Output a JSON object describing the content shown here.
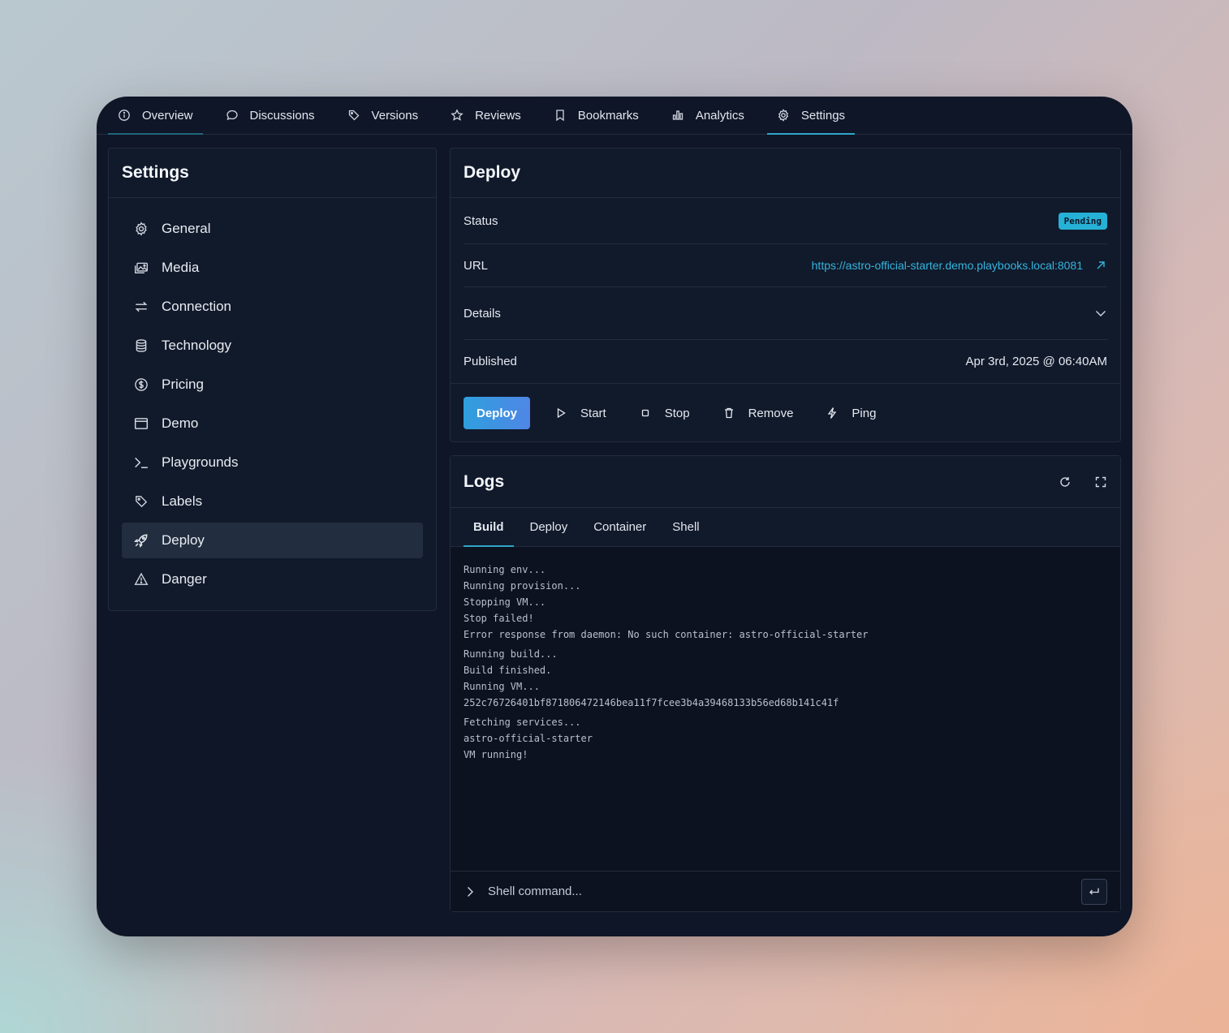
{
  "topnav": {
    "tabs": [
      {
        "label": "Overview",
        "icon": "info-icon"
      },
      {
        "label": "Discussions",
        "icon": "chat-icon"
      },
      {
        "label": "Versions",
        "icon": "tag-icon"
      },
      {
        "label": "Reviews",
        "icon": "star-icon"
      },
      {
        "label": "Bookmarks",
        "icon": "bookmark-icon"
      },
      {
        "label": "Analytics",
        "icon": "bar-chart-icon"
      },
      {
        "label": "Settings",
        "icon": "gear-icon"
      }
    ],
    "active": "Settings"
  },
  "sidebar": {
    "title": "Settings",
    "items": [
      {
        "label": "General",
        "icon": "gear-icon"
      },
      {
        "label": "Media",
        "icon": "image-icon"
      },
      {
        "label": "Connection",
        "icon": "arrows-icon"
      },
      {
        "label": "Technology",
        "icon": "database-icon"
      },
      {
        "label": "Pricing",
        "icon": "dollar-icon"
      },
      {
        "label": "Demo",
        "icon": "window-icon"
      },
      {
        "label": "Playgrounds",
        "icon": "terminal-icon"
      },
      {
        "label": "Labels",
        "icon": "tag-icon"
      },
      {
        "label": "Deploy",
        "icon": "rocket-icon"
      },
      {
        "label": "Danger",
        "icon": "warning-icon"
      }
    ],
    "active": "Deploy"
  },
  "deploy": {
    "title": "Deploy",
    "status_label": "Status",
    "status_value": "Pending",
    "url_label": "URL",
    "url_value": "https://astro-official-starter.demo.playbooks.local:8081",
    "details_label": "Details",
    "published_label": "Published",
    "published_value": "Apr 3rd, 2025 @ 06:40AM",
    "actions": {
      "deploy": "Deploy",
      "start": "Start",
      "stop": "Stop",
      "remove": "Remove",
      "ping": "Ping"
    }
  },
  "logs": {
    "title": "Logs",
    "tabs": [
      "Build",
      "Deploy",
      "Container",
      "Shell"
    ],
    "active_tab": "Build",
    "lines": [
      "Running env...",
      "Running provision...",
      "Stopping VM...",
      "Stop failed!",
      "Error response from daemon: No such container: astro-official-starter",
      "Running build...",
      "Build finished.",
      "Running VM...",
      "252c76726401bf871806472146bea11f7fcee3b4a39468133b56ed68b141c41f",
      "Fetching services...",
      "astro-official-starter",
      "VM running!"
    ],
    "shell_placeholder": "Shell command..."
  },
  "colors": {
    "accent": "#2fa6c8",
    "badge": "#26b1d6",
    "link": "#34b4dc",
    "panel": "#111a2b",
    "window": "#0f1627"
  }
}
